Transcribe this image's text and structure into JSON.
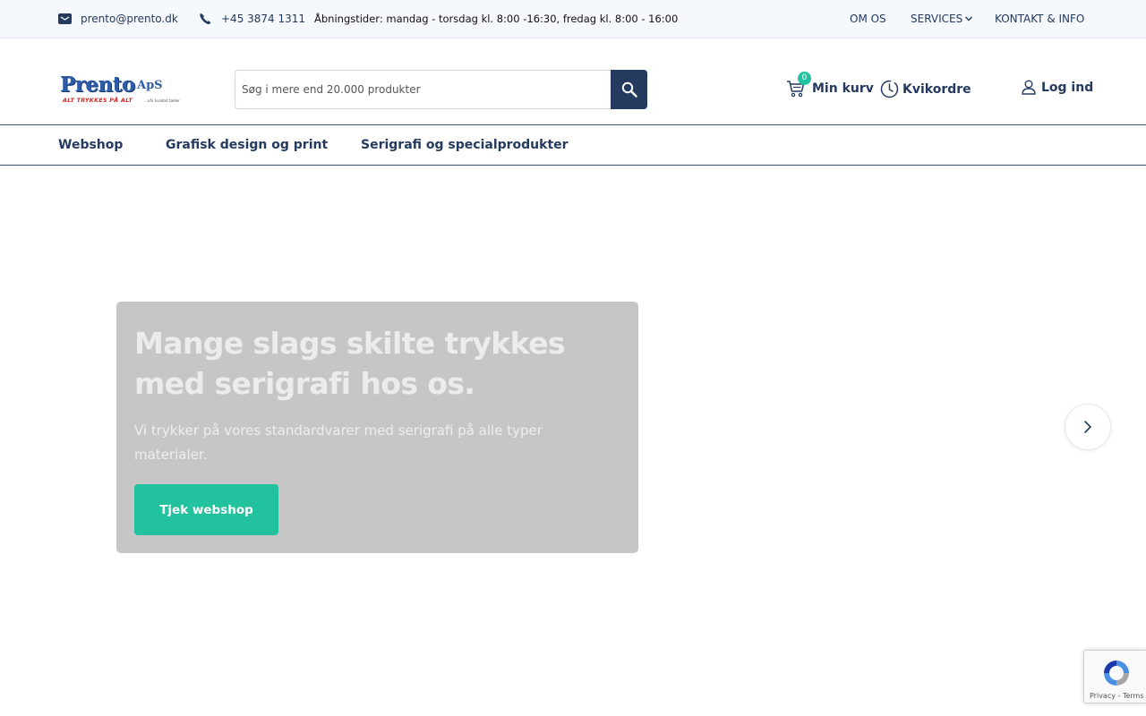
{
  "topbar": {
    "email": "prento@prento.dk",
    "phone": "+45 3874 1311",
    "hours": "Åbningstider: mandag - torsdag kl. 8:00 -16:30, fredag kl. 8:00 - 16:00",
    "links": {
      "about": "OM OS",
      "services": "SERVICES",
      "contact": "KONTAKT & INFO"
    }
  },
  "header": {
    "logo": {
      "name": "Prento",
      "suffix": "ApS",
      "tagline": "ALT TRYKKES PÅ ALT",
      "sub": "...når kvalitet tæller"
    },
    "search": {
      "placeholder": "Søg i mere end 20.000 produkter",
      "value": ""
    },
    "cart": {
      "label": "Min kurv",
      "count": "0"
    },
    "quick_order": "Kvikordre",
    "login": "Log ind"
  },
  "nav": {
    "items": [
      "Webshop",
      "Grafisk design og print",
      "Serigrafi og specialprodukter"
    ]
  },
  "hero": {
    "title": "Mange slags skilte trykkes med serigrafi hos os.",
    "text": "Vi trykker på vores standardvarer med serigrafi på alle typer materialer.",
    "button": "Tjek webshop"
  },
  "recaptcha": {
    "text": "Privacy - Terms"
  },
  "colors": {
    "primary": "#243a5e",
    "accent": "#22c29f",
    "card": "#c6c6c6",
    "topbar_bg": "#f5f8fc"
  }
}
